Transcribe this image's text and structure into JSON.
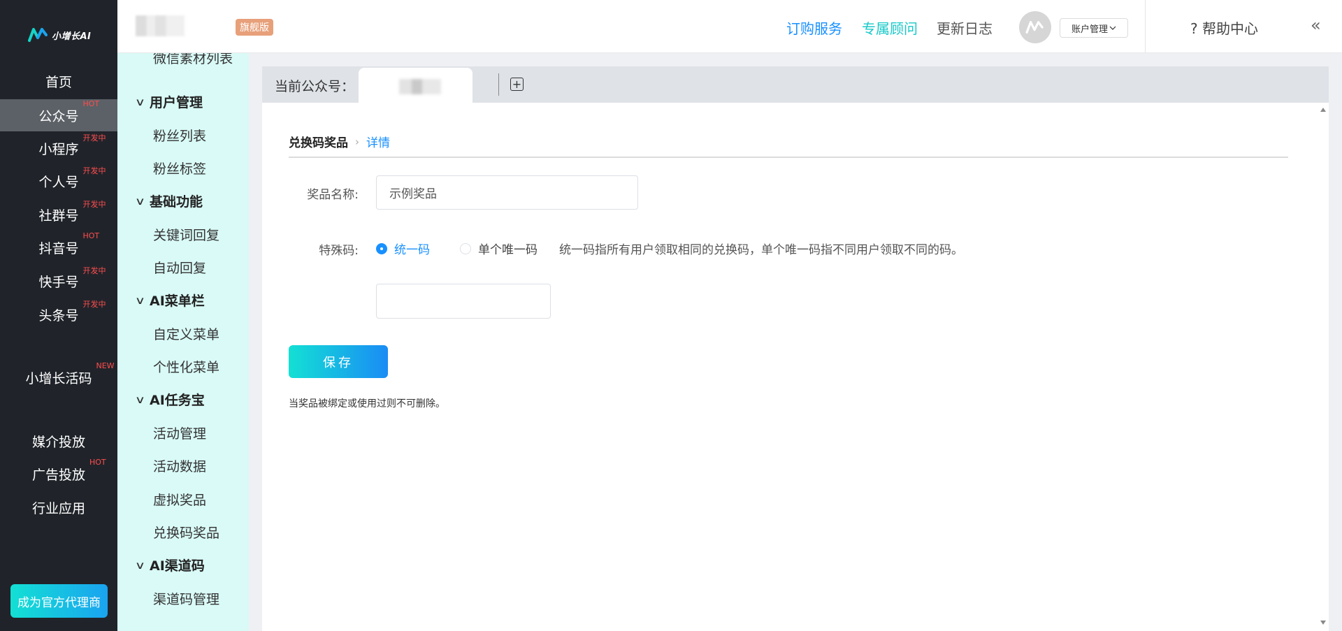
{
  "brand": {
    "name": "小增长AI",
    "edition": "旗舰版"
  },
  "left_nav": {
    "items": [
      {
        "label": "首页",
        "tag": ""
      },
      {
        "label": "公众号",
        "tag": "HOT"
      },
      {
        "label": "小程序",
        "tag": "开发中"
      },
      {
        "label": "个人号",
        "tag": "开发中"
      },
      {
        "label": "社群号",
        "tag": "开发中"
      },
      {
        "label": "抖音号",
        "tag": "HOT"
      },
      {
        "label": "快手号",
        "tag": "开发中"
      },
      {
        "label": "头条号",
        "tag": "开发中"
      },
      {
        "label": "小增长活码",
        "tag": "NEW"
      },
      {
        "label": "媒介投放",
        "tag": ""
      },
      {
        "label": "广告投放",
        "tag": "HOT"
      },
      {
        "label": "行业应用",
        "tag": ""
      }
    ],
    "agent_button": "成为官方代理商"
  },
  "topbar": {
    "subscribe": "订购服务",
    "consultant": "专属顾问",
    "changelog": "更新日志",
    "account_menu": "账户管理",
    "help": "帮助中心",
    "colors": {
      "subscribe": "#1890ff",
      "consultant": "#18c8c8"
    }
  },
  "sub_nav": {
    "top_partial": "微信素材列表",
    "groups": [
      {
        "title": "用户管理",
        "items": [
          "粉丝列表",
          "粉丝标签"
        ]
      },
      {
        "title": "基础功能",
        "items": [
          "关键词回复",
          "自动回复"
        ]
      },
      {
        "title": "AI菜单栏",
        "items": [
          "自定义菜单",
          "个性化菜单"
        ]
      },
      {
        "title": "AI任务宝",
        "items": [
          "活动管理",
          "活动数据",
          "虚拟奖品",
          "兑换码奖品"
        ]
      },
      {
        "title": "AI渠道码",
        "items": [
          "渠道码管理"
        ]
      }
    ]
  },
  "tabbar": {
    "label": "当前公众号："
  },
  "breadcrumb": {
    "parent": "兑换码奖品",
    "current": "详情"
  },
  "form": {
    "name_label": "奖品名称:",
    "name_value": "示例奖品",
    "special_label": "特殊码:",
    "radio_unified": "统一码",
    "radio_unique": "单个唯一码",
    "selected": "统一码",
    "hint": "统一码指所有用户领取相同的兑换码，单个唯一码指不同用户领取不同的码。",
    "code_value": "",
    "save": "保存",
    "note": "当奖品被绑定或使用过则不可删除。"
  }
}
